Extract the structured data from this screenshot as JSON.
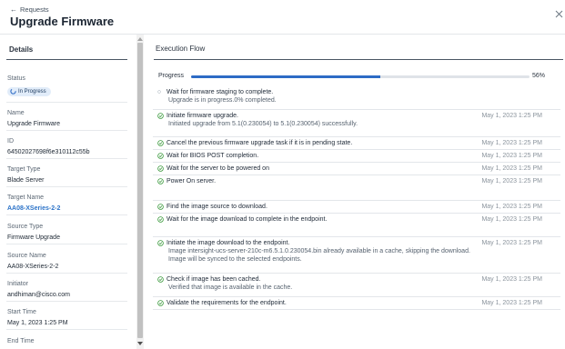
{
  "header": {
    "back_label": "Requests",
    "title": "Upgrade Firmware"
  },
  "details": {
    "title": "Details",
    "status_label": "Status",
    "status_value": "In Progress",
    "name_label": "Name",
    "name_value": "Upgrade Firmware",
    "id_label": "ID",
    "id_value": "64502027698f6e310112c55b",
    "target_type_label": "Target Type",
    "target_type_value": "Blade Server",
    "target_name_label": "Target Name",
    "target_name_value": "AA08-XSeries-2-2",
    "source_type_label": "Source Type",
    "source_type_value": "Firmware Upgrade",
    "source_name_label": "Source Name",
    "source_name_value": "AA08-XSeries-2-2",
    "initiator_label": "Initiator",
    "initiator_value": "andhiman@cisco.com",
    "start_time_label": "Start Time",
    "start_time_value": "May 1, 2023 1:25 PM",
    "end_time_label": "End Time"
  },
  "execution": {
    "title": "Execution Flow",
    "progress_label": "Progress",
    "progress_percent_text": "56%",
    "progress_fraction": 0.56,
    "accent_color": "#2d6bc5",
    "success_color": "#3c9a3e",
    "steps": [
      {
        "title": "Wait for firmware staging to complete.",
        "desc": "Upgrade is in progress.0% completed.",
        "time": "",
        "state": "in-progress"
      },
      {
        "title": "Initiate firmware upgrade.",
        "desc": "Initiated upgrade from 5.1(0.230054) to 5.1(0.230054) successfully.",
        "time": "May 1, 2023 1:25 PM",
        "state": "done"
      },
      {
        "title": "Cancel the previous firmware upgrade task if it is in pending state.",
        "desc": "",
        "time": "May 1, 2023 1:25 PM",
        "state": "done"
      },
      {
        "title": "Wait for BIOS POST completion.",
        "desc": "",
        "time": "May 1, 2023 1:25 PM",
        "state": "done"
      },
      {
        "title": "Wait for the server to be powered on",
        "desc": "",
        "time": "May 1, 2023 1:25 PM",
        "state": "done"
      },
      {
        "title": "Power On server.",
        "desc": "",
        "time": "May 1, 2023 1:25 PM",
        "state": "done"
      },
      {
        "title": "Find the image source to download.",
        "desc": "",
        "time": "May 1, 2023 1:25 PM",
        "state": "done"
      },
      {
        "title": "Wait for the image download to complete in the endpoint.",
        "desc": "",
        "time": "May 1, 2023 1:25 PM",
        "state": "done"
      },
      {
        "title": "Initiate the image download to the endpoint.",
        "desc": "Image intersight-ucs-server-210c-m6.5.1.0.230054.bin already available in a cache, skipping the download. Image will be synced to the selected endpoints.",
        "time": "May 1, 2023 1:25 PM",
        "state": "done"
      },
      {
        "title": "Check if image has been cached.",
        "desc": "Verified that image is available in the cache.",
        "time": "May 1, 2023 1:25 PM",
        "state": "done"
      },
      {
        "title": "Validate the requirements for the endpoint.",
        "desc": "",
        "time": "May 1, 2023 1:25 PM",
        "state": "done"
      }
    ]
  }
}
